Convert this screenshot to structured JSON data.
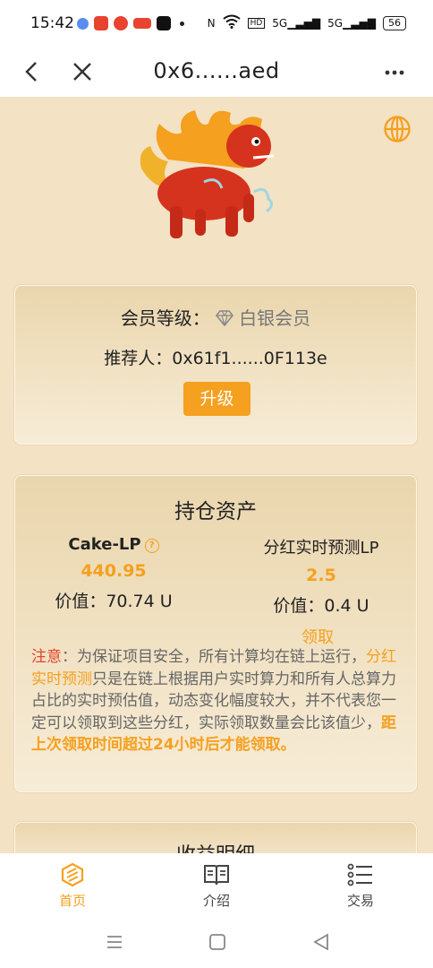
{
  "status_bar": {
    "time": "15:42",
    "signal_1": "5G",
    "signal_2": "5G",
    "battery": "56"
  },
  "nav": {
    "title": "0x6......aed"
  },
  "member_card": {
    "level_label": "会员等级：",
    "level_value": "白银会员",
    "referrer": "推荐人：0x61f1......0F113e",
    "upgrade_label": "升级"
  },
  "holdings": {
    "title": "持仓资产",
    "left": {
      "name": "Cake-LP",
      "amount": "440.95",
      "value": "价值：70.74 U"
    },
    "right": {
      "name": "分红实时预测LP",
      "amount": "2.5",
      "value": "价值：0.4 U"
    },
    "claim_label": "领取",
    "notice": {
      "prefix": "注意",
      "part1": "：为保证项目安全，所有计算均在链上运行，",
      "highlight1": "分红实时预测",
      "part2": "只是在链上根据用户实时算力和所有人总算力占比的实时预估值，动态变化幅度较大，并不代表您一定可以领取到这些分红，实际领取数量会比该值少，",
      "highlight2": "距上次领取时间超过24小时后才能领取。"
    }
  },
  "earnings": {
    "title": "收益明细"
  },
  "tabs": {
    "home": "首页",
    "intro": "介绍",
    "trade": "交易"
  },
  "colors": {
    "accent": "#f5a01f",
    "warning": "#e2462c",
    "background": "#f3e2c4"
  }
}
